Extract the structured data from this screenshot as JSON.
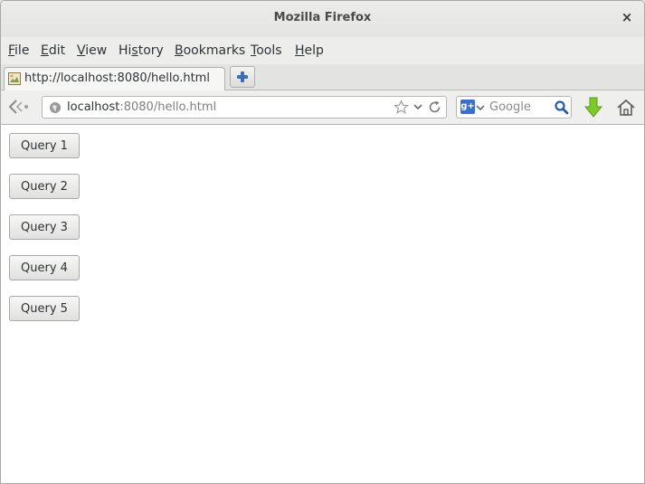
{
  "window": {
    "title": "Mozilla Firefox",
    "close_label": "×"
  },
  "menu": [
    {
      "label": "File",
      "accel": "F",
      "rest": "ile"
    },
    {
      "label": "Edit",
      "accel": "E",
      "rest": "dit"
    },
    {
      "label": "View",
      "accel": "V",
      "rest": "iew"
    },
    {
      "label": "History",
      "pre": "Hi",
      "accel": "s",
      "rest": "tory"
    },
    {
      "label": "Bookmarks",
      "accel": "B",
      "rest": "ookmarks"
    },
    {
      "label": "Tools",
      "accel": "T",
      "rest": "ools"
    },
    {
      "label": "Help",
      "accel": "H",
      "rest": "elp"
    }
  ],
  "tabs": [
    {
      "title": "http://localhost:8080/hello.html",
      "active": true,
      "favicon": "broken-image-icon"
    }
  ],
  "navbar": {
    "url_host": "localhost",
    "url_rest": ":8080/hello.html",
    "search_engine": "Google",
    "search_placeholder": "Google",
    "search_engine_glyph": "g+"
  },
  "content": {
    "buttons": [
      "Query 1",
      "Query 2",
      "Query 3",
      "Query 4",
      "Query 5"
    ]
  },
  "colors": {
    "download_arrow": "#7ec82a",
    "search_engine_badge": "#3b6ec6",
    "new_tab_plus": "#3a6fb8"
  },
  "icons": [
    "back-arrow-icon",
    "globe-icon",
    "star-icon",
    "chevron-down-icon",
    "reload-icon",
    "search-icon",
    "download-arrow-icon",
    "home-icon",
    "plus-icon",
    "close-icon"
  ]
}
